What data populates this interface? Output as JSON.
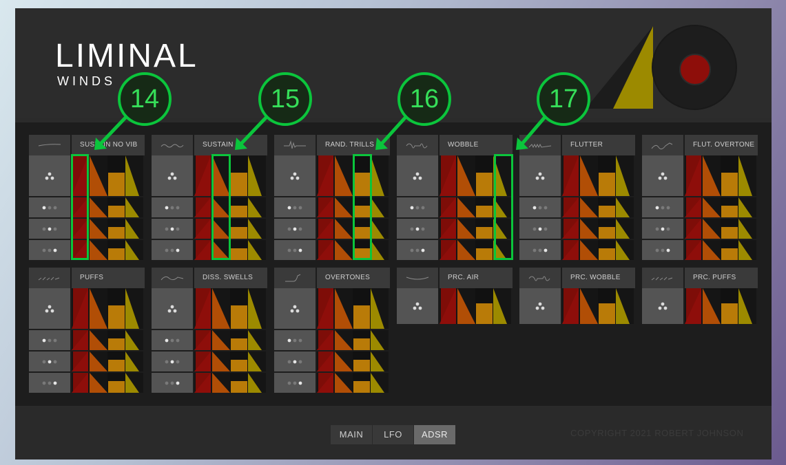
{
  "brand": {
    "name": "LIMINAL",
    "sub": "WINDS"
  },
  "colors": {
    "red": "#8e0e0a",
    "orange": "#b14e06",
    "amber": "#b97b08",
    "olive": "#9c8a00",
    "annotation": "#0bc53c"
  },
  "panels": [
    {
      "title": "SUSTAIN NO VIB",
      "rows": 4,
      "icon": "flat-line-icon"
    },
    {
      "title": "SUSTAIN",
      "rows": 4,
      "icon": "vibrato-wave-icon"
    },
    {
      "title": "RAND. TRILLS",
      "rows": 4,
      "icon": "trill-wave-icon"
    },
    {
      "title": "WOBBLE",
      "rows": 4,
      "icon": "wobble-wave-icon"
    },
    {
      "title": "FLUTTER",
      "rows": 4,
      "icon": "flutter-wave-icon"
    },
    {
      "title": "FLUT. OVERTONE",
      "rows": 4,
      "icon": "flutter-overtone-icon"
    },
    {
      "title": "PUFFS",
      "rows": 4,
      "icon": "puff-wave-icon"
    },
    {
      "title": "DISS. SWELLS",
      "rows": 4,
      "icon": "swell-wave-icon"
    },
    {
      "title": "OVERTONES",
      "rows": 4,
      "icon": "overtone-wave-icon"
    },
    {
      "title": "PRC. AIR",
      "rows": 1,
      "icon": "arc-icon"
    },
    {
      "title": "PRC. WOBBLE",
      "rows": 1,
      "icon": "wobble-wave-icon"
    },
    {
      "title": "PRC. PUFFS",
      "rows": 1,
      "icon": "puff-wave-icon"
    }
  ],
  "annotations": [
    "14",
    "15",
    "16",
    "17"
  ],
  "nav": {
    "main": "MAIN",
    "lfo": "LFO",
    "adsr": "ADSR",
    "active": "ADSR"
  },
  "copyright": "COPYRIGHT 2021 ROBERT JOHNSON"
}
